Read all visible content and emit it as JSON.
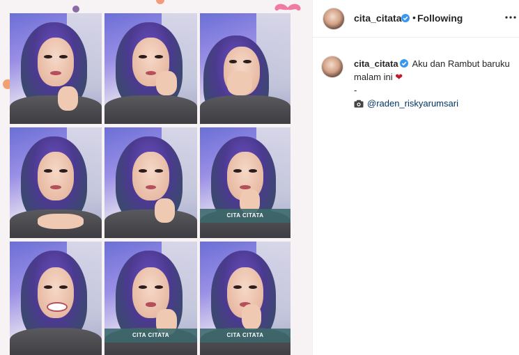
{
  "post": {
    "username": "cita_citata",
    "separator": "•",
    "follow_status": "Following",
    "more_icon": "more-horizontal-icon",
    "verified_icon": "verified-badge-icon"
  },
  "caption": {
    "username": "cita_citata",
    "text": "Aku dan Rambut baruku malam ini",
    "emoji": "❤",
    "dash": "-",
    "camera_icon": "camera-icon",
    "mention": "@raden_riskyarumsari"
  },
  "media": {
    "tile_captions": [
      "CITA CITATA",
      "CITA CITATA",
      "CITA CITATA"
    ]
  },
  "colors": {
    "verified": "#3897f0",
    "mention": "#003569",
    "heart": "#c4182b",
    "caption_bar": "#3a686c"
  }
}
